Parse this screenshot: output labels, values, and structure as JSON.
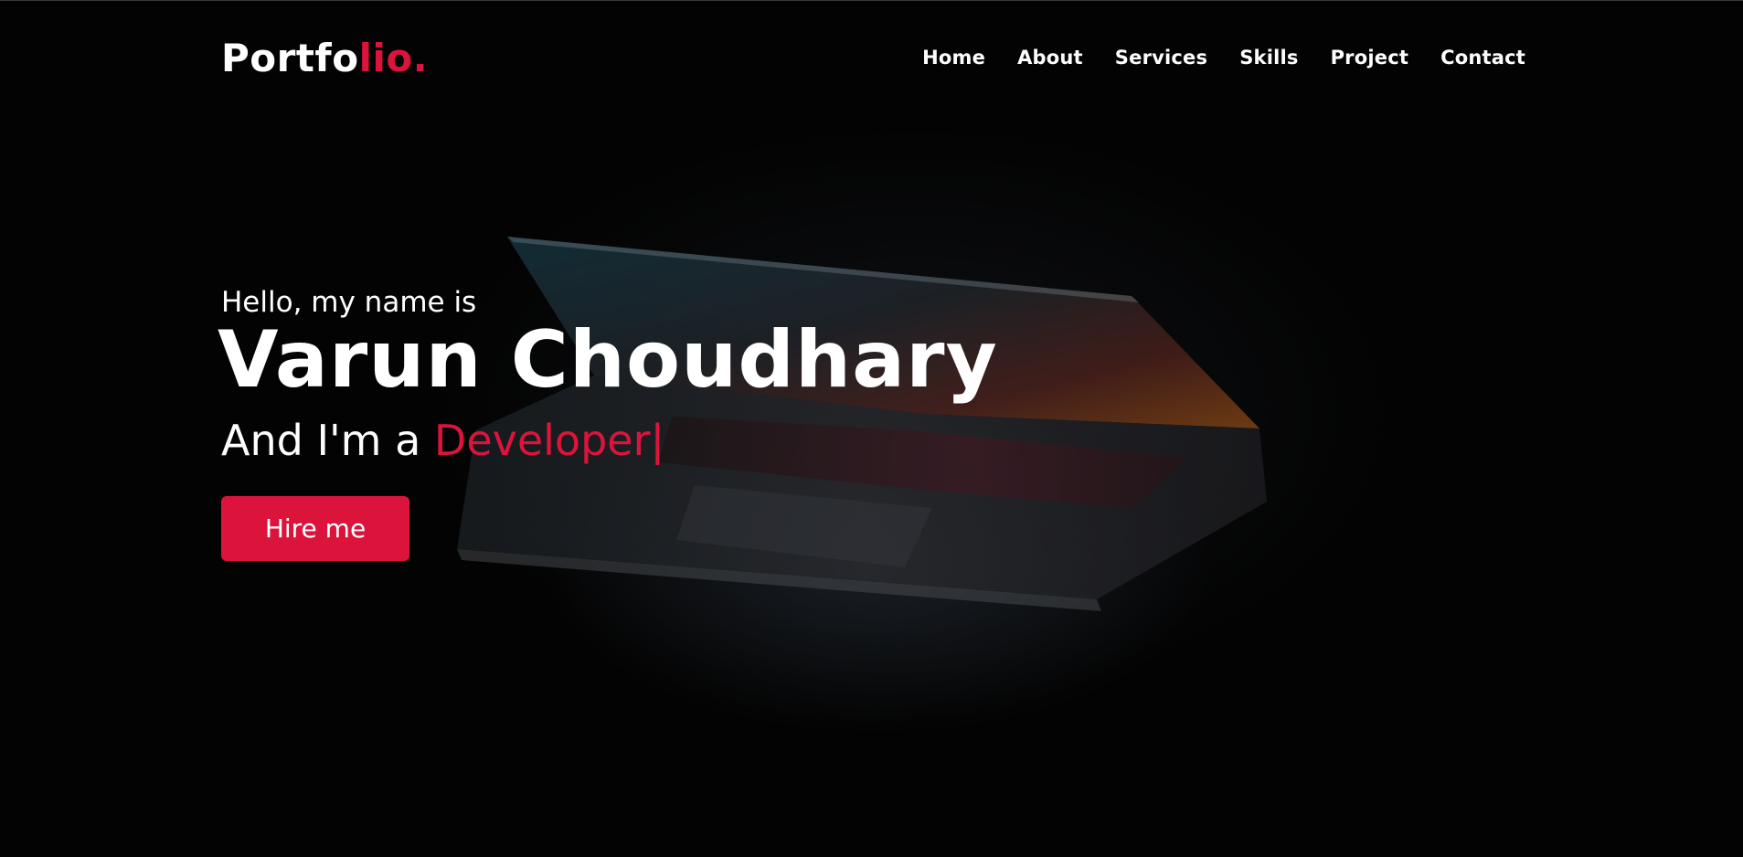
{
  "navbar": {
    "logo_main": "Portfo",
    "logo_accent": "lio.",
    "items": [
      {
        "label": "Home"
      },
      {
        "label": "About"
      },
      {
        "label": "Services"
      },
      {
        "label": "Skills"
      },
      {
        "label": "Project"
      },
      {
        "label": "Contact"
      }
    ]
  },
  "hero": {
    "greeting": "Hello, my name is",
    "name": "Varun Choudhary",
    "tagline_prefix": "And I'm a ",
    "role": "Developer|",
    "cta_label": "Hire me",
    "background_icon": "laptop-image"
  },
  "colors": {
    "accent": "#dc143c",
    "background": "#030303",
    "text": "#ffffff"
  }
}
